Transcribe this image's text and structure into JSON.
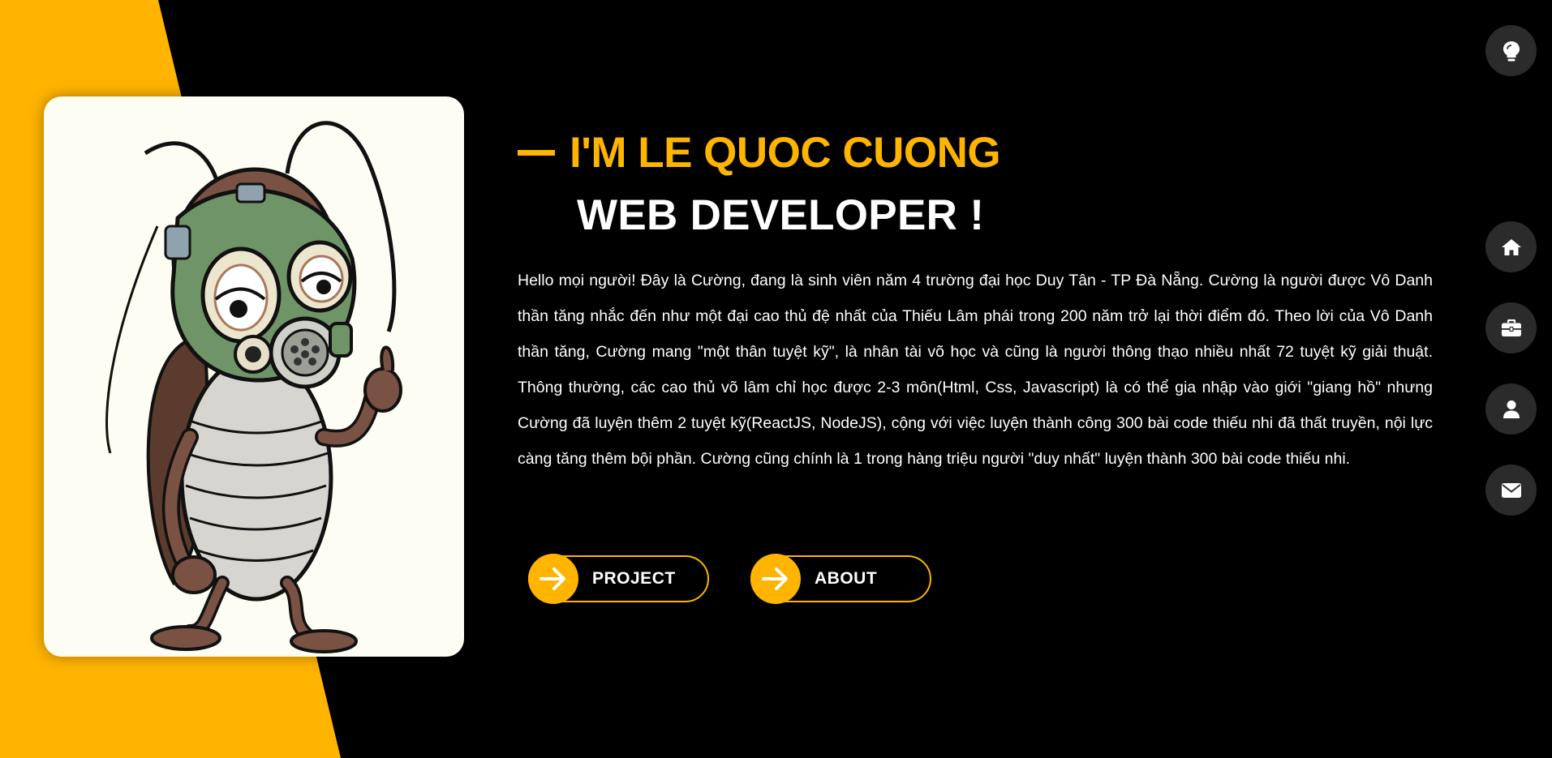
{
  "hero": {
    "greeting": "I'M LE QUOC CUONG",
    "role": "WEB DEVELOPER !",
    "bio": "Hello mọi người! Đây là Cường, đang là sinh viên năm 4 trường đại học Duy Tân - TP Đà Nẵng. Cường là người được Vô Danh thần tăng nhắc đến như một đại cao thủ đệ nhất của Thiếu Lâm phái trong 200 năm trở lại thời điểm đó. Theo lời của Vô Danh thần tăng, Cường mang \"một thân tuyệt kỹ\", là nhân tài võ học và cũng là người thông thạo nhiều nhất 72 tuyệt kỹ giải thuật. Thông thường, các cao thủ võ lâm chỉ học được 2-3 môn(Html, Css, Javascript) là có thể gia nhập vào giới \"giang hồ\" nhưng Cường đã luyện thêm 2 tuyệt kỹ(ReactJS, NodeJS), cộng với việc luyện thành công 300 bài code thiếu nhi đã thất truyền, nội lực càng tăng thêm bội phần. Cường cũng chính là 1 trong hàng triệu người \"duy nhất\" luyện thành 300 bài code thiếu nhi."
  },
  "buttons": {
    "project_label": "PROJECT",
    "about_label": "ABOUT",
    "icon": "arrow-right-icon"
  },
  "side_nav": {
    "items": [
      {
        "icon": "lightbulb-icon"
      },
      {
        "icon": "home-icon"
      },
      {
        "icon": "briefcase-icon"
      },
      {
        "icon": "user-icon"
      },
      {
        "icon": "envelope-icon"
      }
    ]
  },
  "colors": {
    "accent": "#ffb400",
    "background": "#000000",
    "card": "#fefdf3",
    "nav_button": "#2b2b2b"
  }
}
